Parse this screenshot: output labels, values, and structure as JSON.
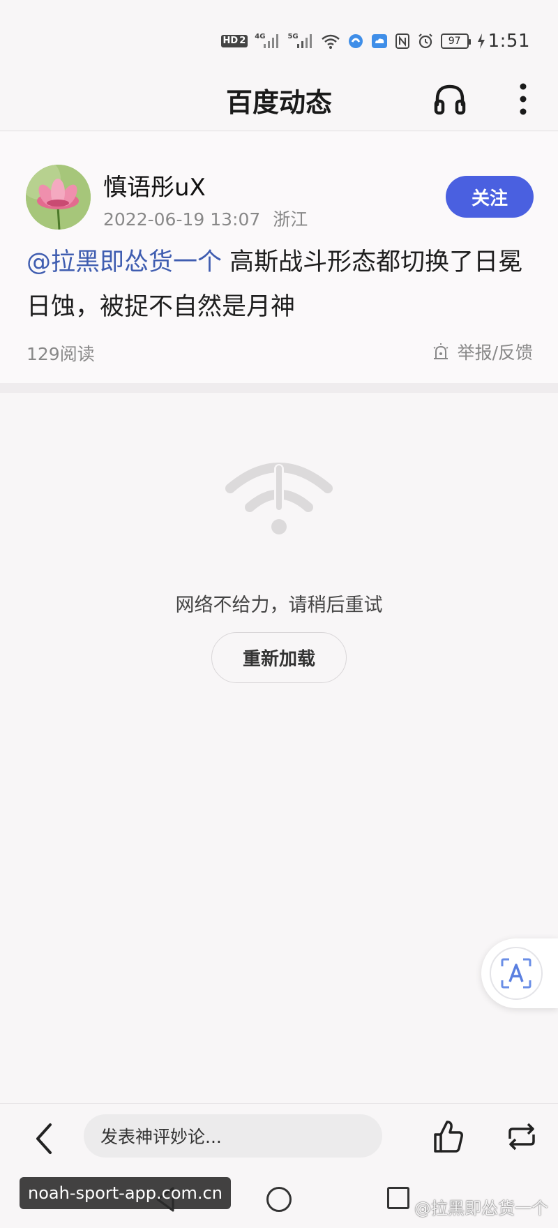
{
  "status_bar": {
    "time": "1:51",
    "battery": "97",
    "hd_badge": "HD",
    "sim_number": "2",
    "network_4g": "4G",
    "network_5g": "5G",
    "icons": [
      "hd-badge",
      "signal-4g-icon",
      "signal-5g-icon",
      "wifi-icon",
      "app-notification-icon",
      "cloud-icon",
      "nfc-icon",
      "alarm-icon",
      "battery-icon",
      "charging-icon"
    ]
  },
  "header": {
    "title": "百度动态",
    "icons": [
      "headphones-icon",
      "more-vertical-icon"
    ]
  },
  "post": {
    "author": "慎语彤uX",
    "date": "2022-06-19 13:07",
    "location": "浙江",
    "follow_label": "关注",
    "mention": "@拉黑即怂货一个",
    "text": " 高斯战斗形态都切换了日冕日蚀，被捉不自然是月神",
    "read_count": "129阅读",
    "report_label": "举报/反馈"
  },
  "error_state": {
    "message": "网络不给力，请稍后重试",
    "reload_label": "重新加载"
  },
  "bottom_bar": {
    "comment_placeholder": "发表神评妙论..."
  },
  "watermarks": {
    "left": "noah-sport-app.com.cn",
    "right": "@拉黑即怂货一个"
  },
  "colors": {
    "accent": "#4a60e0",
    "mention": "#3f5db0",
    "background": "#f8f6f7"
  }
}
